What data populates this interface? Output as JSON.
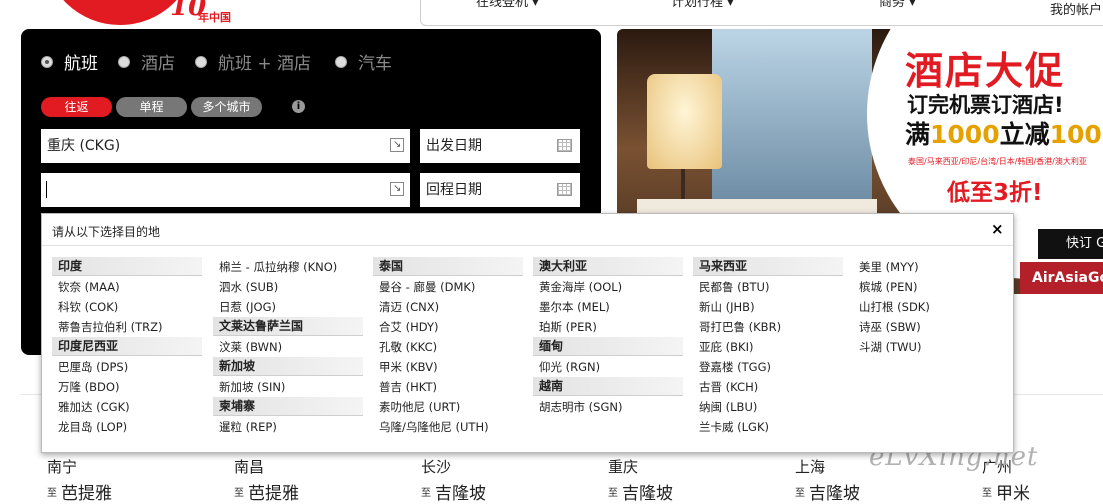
{
  "logo": {
    "num": "10",
    "cn": "年中国"
  },
  "topnav": {
    "items": [
      "在线登机 ▾",
      "计划行程 ▾",
      "商务 ▾"
    ],
    "account": "我的帐户"
  },
  "search": {
    "tabs": [
      "航班",
      "酒店",
      "航班 + 酒店",
      "汽车"
    ],
    "trip_types": [
      "往返",
      "单程",
      "多个城市"
    ],
    "info_icon": "i",
    "origin": "重庆 (CKG)",
    "destination": "",
    "depart_date": "出发日期",
    "return_date": "回程日期"
  },
  "promo": {
    "title": "酒店大促",
    "line2": "订完机票订酒店!",
    "line3_a": "满",
    "line3_b": "1000",
    "line3_c": "立减",
    "line3_d": "100",
    "countries": "泰国/马来西亚/印尼/台湾/日本/韩国/香港/澳大利亚",
    "line5": "低至3折!",
    "book_button": "快订 G",
    "brand": "AirAsiaGo"
  },
  "popup": {
    "title": "请从以下选择目的地",
    "close": "×",
    "columns": [
      [
        {
          "category": "印度",
          "airports": [
            "钦奈 (MAA)",
            "科钦 (COK)",
            "蒂鲁吉拉伯利 (TRZ)"
          ]
        },
        {
          "category": "印度尼西亚",
          "airports": [
            "巴厘岛 (DPS)",
            "万隆 (BDO)",
            "雅加达 (CGK)",
            "龙目岛 (LOP)"
          ]
        }
      ],
      [
        {
          "category": "",
          "airports": [
            "棉兰 - 瓜拉纳穆 (KNO)",
            "泗水 (SUB)",
            "日惹 (JOG)"
          ]
        },
        {
          "category": "文莱达鲁萨兰国",
          "airports": [
            "汶莱 (BWN)"
          ]
        },
        {
          "category": "新加坡",
          "airports": [
            "新加坡 (SIN)"
          ]
        },
        {
          "category": "柬埔寨",
          "airports": [
            "暹粒 (REP)"
          ]
        }
      ],
      [
        {
          "category": "泰国",
          "airports": [
            "曼谷 - 廊曼 (DMK)",
            "清迈 (CNX)",
            "合艾 (HDY)",
            "孔敬 (KKC)",
            "甲米 (KBV)",
            "普吉 (HKT)",
            "素叻他尼 (URT)",
            "乌隆/乌隆他尼 (UTH)"
          ]
        }
      ],
      [
        {
          "category": "澳大利亚",
          "airports": [
            "黄金海岸 (OOL)",
            "墨尔本 (MEL)",
            "珀斯 (PER)"
          ]
        },
        {
          "category": "缅甸",
          "airports": [
            "仰光 (RGN)"
          ]
        },
        {
          "category": "越南",
          "airports": [
            "胡志明市 (SGN)"
          ]
        }
      ],
      [
        {
          "category": "马来西亚",
          "airports": [
            "民都鲁 (BTU)",
            "新山 (JHB)",
            "哥打巴鲁 (KBR)",
            "亚庇 (BKI)",
            "登嘉楼 (TGG)",
            "古晋 (KCH)",
            "纳闽 (LBU)",
            "兰卡威 (LGK)"
          ]
        }
      ],
      [
        {
          "category": "",
          "airports": [
            "美里 (MYY)",
            "槟城 (PEN)",
            "山打根 (SDK)",
            "诗巫 (SBW)",
            "斗湖 (TWU)"
          ]
        }
      ]
    ]
  },
  "routes": [
    {
      "from": "南宁",
      "to": "至",
      "dest": "芭提雅"
    },
    {
      "from": "南昌",
      "to": "至",
      "dest": "芭提雅"
    },
    {
      "from": "长沙",
      "to": "至",
      "dest": "吉隆坡"
    },
    {
      "from": "重庆",
      "to": "至",
      "dest": "吉隆坡"
    },
    {
      "from": "上海",
      "to": "至",
      "dest": "吉隆坡"
    },
    {
      "from": "广州",
      "to": "至",
      "dest": "甲米"
    }
  ],
  "watermark": "eLvXing.net"
}
